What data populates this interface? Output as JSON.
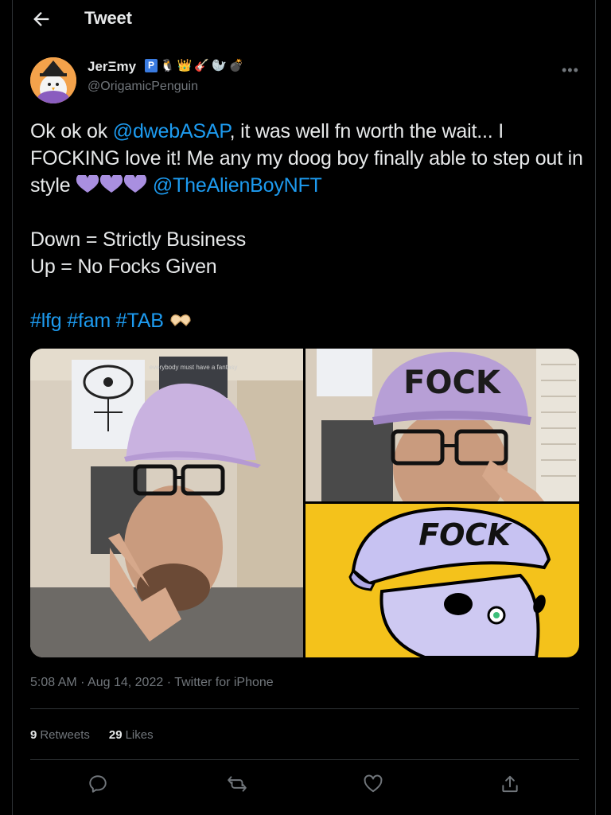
{
  "header": {
    "title": "Tweet"
  },
  "author": {
    "name": "JerΞmy",
    "badges": [
      "P",
      "🐧",
      "👑",
      "🎸",
      "🦭",
      "💣"
    ],
    "handle": "@OrigamicPenguin"
  },
  "tweet": {
    "line1_pre": "Ok ok ok ",
    "mention1": "@dwebASAP",
    "line1_post": ", it was well fn worth the wait... I FOCKING love it! Me any my doog boy finally able to step out in style ",
    "mention2": "@TheAlienBoyNFT",
    "line2": "Down = Strictly Business",
    "line3": "Up = No Focks Given",
    "hashtag1": "#lfg",
    "hashtag2": "#fam",
    "hashtag3": "#TAB"
  },
  "media": {
    "poster_text": "everybody must have a fantasy",
    "hat_text_photo": "FOCK",
    "hat_text_cartoon": "FOCK"
  },
  "meta": {
    "time": "5:08 AM",
    "sep1": " · ",
    "date": "Aug 14, 2022",
    "sep2": " · ",
    "source": "Twitter for iPhone"
  },
  "stats": {
    "retweets_count": "9",
    "retweets_label": "Retweets",
    "likes_count": "29",
    "likes_label": "Likes"
  },
  "icons": {
    "back": "arrow-left-icon",
    "more": "more-horizontal-icon",
    "reply": "reply-icon",
    "retweet": "retweet-icon",
    "like": "heart-icon",
    "share": "share-icon"
  },
  "colors": {
    "background": "#000000",
    "text": "#e7e9ea",
    "secondary": "#71767b",
    "link": "#1d9bf0",
    "purple_heart": "#a98fe0",
    "cartoon_bg": "#f4c21b"
  }
}
